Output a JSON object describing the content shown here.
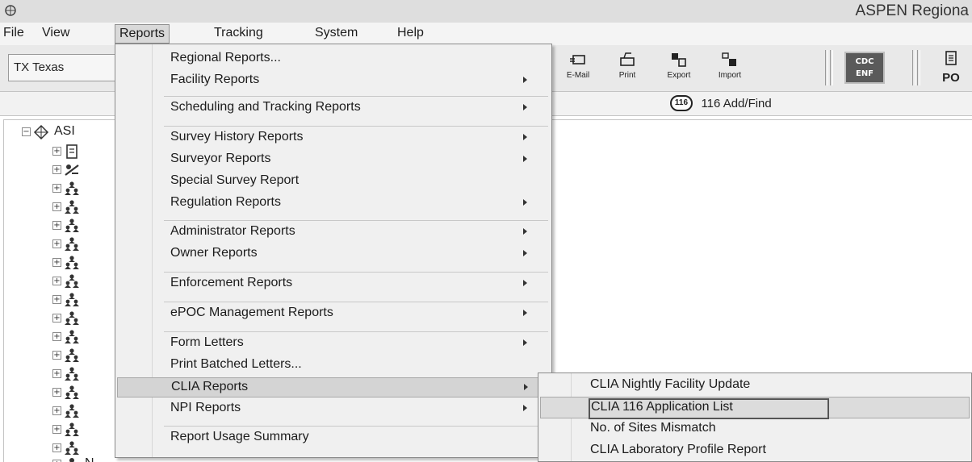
{
  "window": {
    "title": "ASPEN Regiona",
    "app_icon": "aspen-globe-icon"
  },
  "menubar": {
    "items": [
      {
        "label": "File"
      },
      {
        "label": "View"
      },
      {
        "label": "Reports"
      },
      {
        "label": "Tracking"
      },
      {
        "label": "System"
      },
      {
        "label": "Help"
      }
    ],
    "active": "Reports"
  },
  "toolbar": {
    "state_select": "TX Texas",
    "buttons": [
      {
        "label": "E-Mail",
        "icon": "email-icon"
      },
      {
        "label": "Print",
        "icon": "print-icon"
      },
      {
        "label": "Export",
        "icon": "export-icon"
      },
      {
        "label": "Import",
        "icon": "import-icon"
      }
    ],
    "cdc_enf": {
      "line1": "CDC",
      "line2": "ENF"
    },
    "po_label": "PO"
  },
  "tabstrip": {
    "badge": "116",
    "add_find_label": "116 Add/Find"
  },
  "tree": {
    "root_label": "ASI",
    "last_label": "N",
    "nodes": [
      {
        "icon": "document-icon"
      },
      {
        "icon": "surveyor-icon"
      },
      {
        "icon": "facility-group-icon"
      },
      {
        "icon": "facility-group-icon"
      },
      {
        "icon": "facility-group-icon"
      },
      {
        "icon": "facility-group-icon"
      },
      {
        "icon": "facility-group-icon"
      },
      {
        "icon": "facility-group-icon"
      },
      {
        "icon": "facility-group-icon"
      },
      {
        "icon": "facility-group-icon"
      },
      {
        "icon": "facility-group-icon"
      },
      {
        "icon": "facility-group-icon"
      },
      {
        "icon": "facility-group-icon"
      },
      {
        "icon": "facility-group-icon"
      },
      {
        "icon": "facility-group-icon"
      },
      {
        "icon": "facility-group-icon"
      },
      {
        "icon": "facility-group-icon"
      }
    ]
  },
  "reports_menu": {
    "items": [
      {
        "label": "Regional Reports...",
        "submenu": false
      },
      {
        "label": "Facility Reports",
        "submenu": true
      },
      {
        "label": "Scheduling and Tracking Reports",
        "submenu": true
      },
      {
        "label": "Survey History Reports",
        "submenu": true
      },
      {
        "label": "Surveyor Reports",
        "submenu": true
      },
      {
        "label": "Special Survey Report",
        "submenu": false
      },
      {
        "label": "Regulation Reports",
        "submenu": true
      },
      {
        "label": "Administrator Reports",
        "submenu": true
      },
      {
        "label": "Owner Reports",
        "submenu": true
      },
      {
        "label": "Enforcement Reports",
        "submenu": true
      },
      {
        "label": "ePOC Management Reports",
        "submenu": true
      },
      {
        "label": "Form Letters",
        "submenu": true
      },
      {
        "label": "Print Batched Letters...",
        "submenu": false
      },
      {
        "label": "CLIA Reports",
        "submenu": true
      },
      {
        "label": "NPI Reports",
        "submenu": true
      },
      {
        "label": "Report Usage Summary",
        "submenu": false
      }
    ],
    "highlighted": "CLIA Reports"
  },
  "clia_submenu": {
    "items": [
      {
        "label": "CLIA Nightly Facility Update"
      },
      {
        "label": "CLIA 116 Application List"
      },
      {
        "label": "No. of Sites Mismatch"
      },
      {
        "label": "CLIA Laboratory Profile Report"
      }
    ],
    "highlighted": "CLIA 116 Application List"
  }
}
